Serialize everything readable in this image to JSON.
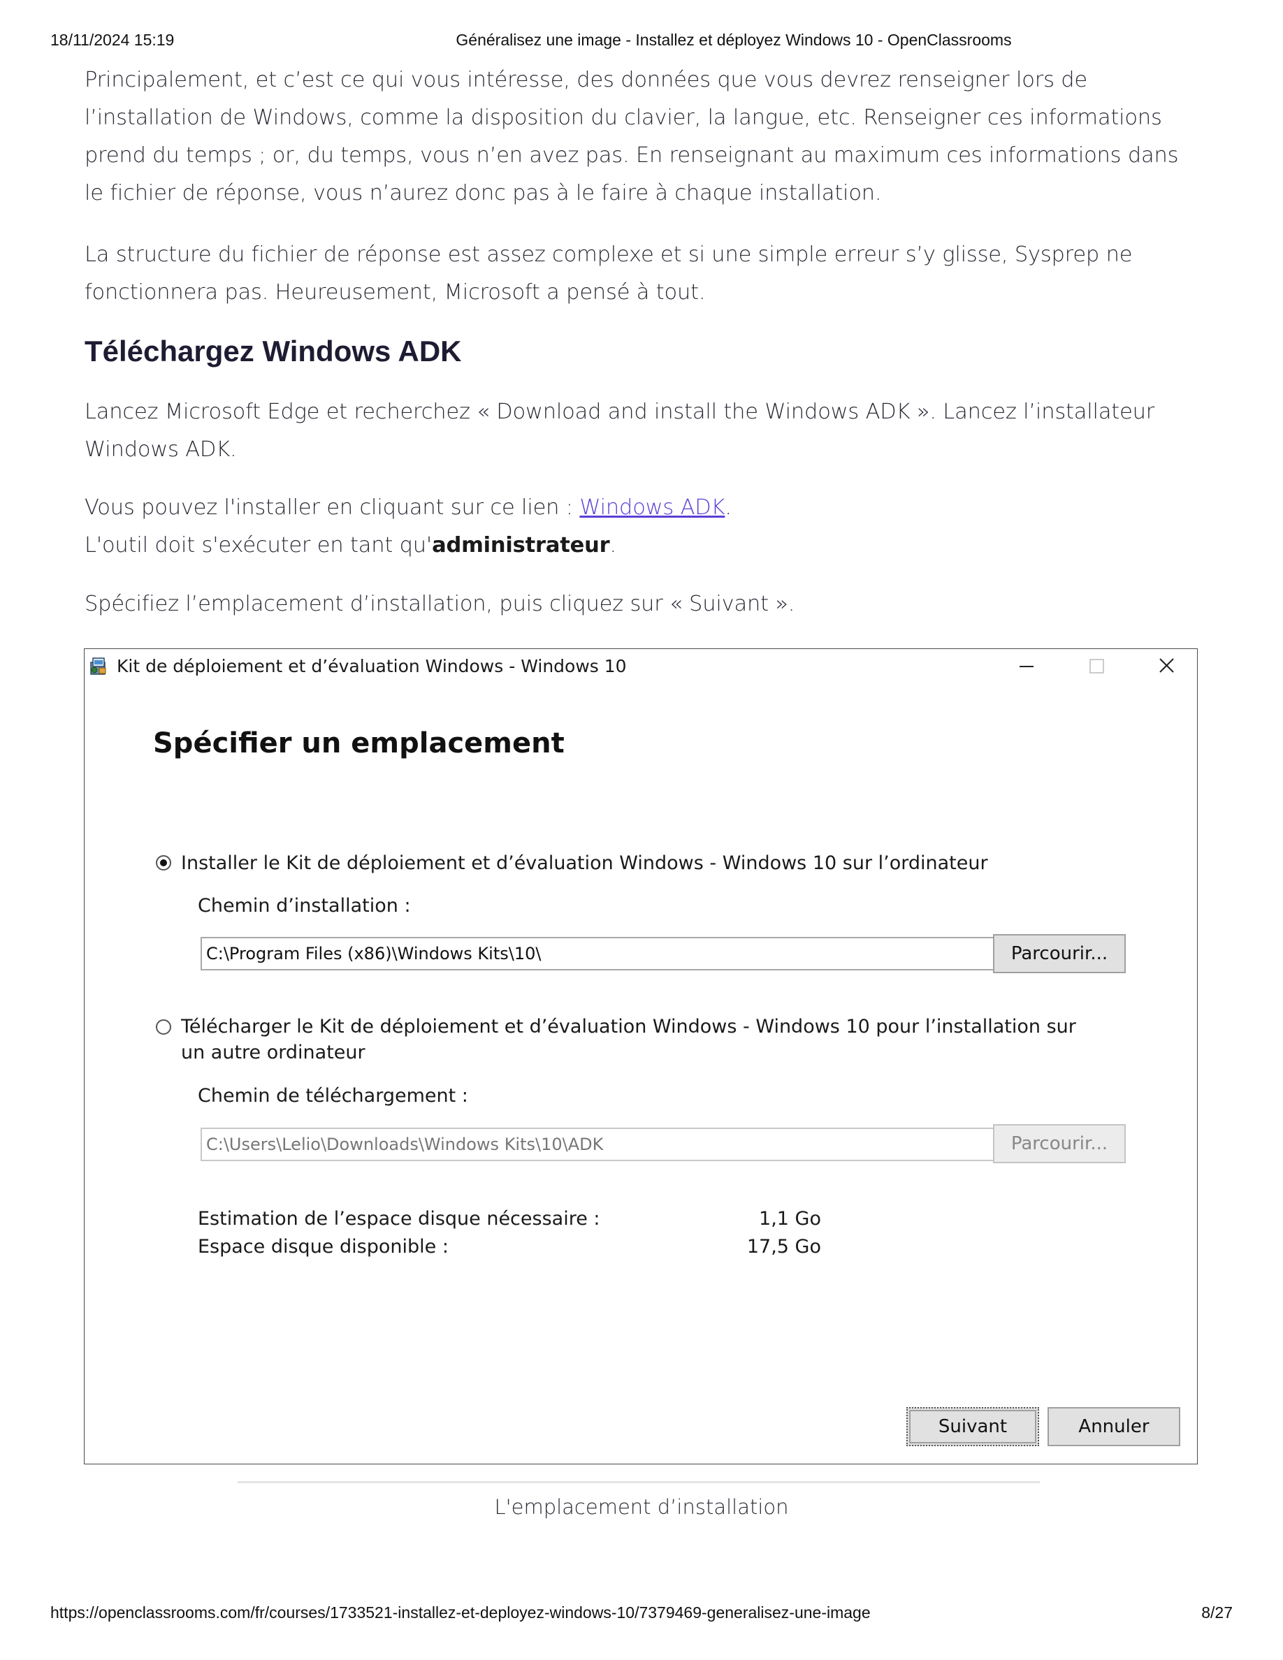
{
  "print_header": {
    "date": "18/11/2024 15:19",
    "title": "Généralisez une image - Installez et déployez Windows 10 - OpenClassrooms"
  },
  "article": {
    "p1": "Principalement, et c’est ce qui vous intéresse, des données que vous devrez renseigner lors de l’installation de Windows, comme la disposition du clavier, la langue, etc. Renseigner ces informations prend du temps ; or, du temps, vous n’en avez pas. En renseignant au maximum ces informations dans le fichier de réponse, vous n’aurez donc pas à le faire à chaque installation.",
    "p2": "La structure du fichier de réponse est assez complexe et si une simple erreur s’y glisse, Sysprep ne fonctionnera pas. Heureusement, Microsoft a pensé à tout.",
    "heading": "Téléchargez Windows ADK",
    "p3": "Lancez Microsoft Edge et recherchez « Download and install the Windows ADK ». Lancez l’installateur Windows ADK.",
    "p4_prefix": "Vous pouvez l'installer en cliquant sur ce lien : ",
    "p4_link": "Windows ADK",
    "p4_suffix": ".",
    "p4b_prefix": "L'outil doit s'exécuter en tant qu'",
    "p4b_bold": "administrateur",
    "p4b_suffix": ".",
    "p5": "Spécifiez l’emplacement d’installation, puis cliquez sur « Suivant ».",
    "caption": "L'emplacement d’installation"
  },
  "dialog": {
    "window_title": "Kit de déploiement et d’évaluation Windows - Windows 10",
    "heading": "Spécifier un emplacement",
    "option1_label": "Installer le Kit de déploiement et d’évaluation Windows - Windows 10 sur l’ordinateur",
    "option1_selected": true,
    "install_path_label": "Chemin d’installation :",
    "install_path_value": "C:\\Program Files (x86)\\Windows Kits\\10\\",
    "browse_label": "Parcourir...",
    "option2_label": "Télécharger le Kit de déploiement et d’évaluation Windows - Windows 10 pour l’installation sur un autre ordinateur",
    "option2_selected": false,
    "download_path_label": "Chemin de téléchargement :",
    "download_path_value": "C:\\Users\\Lelio\\Downloads\\Windows Kits\\10\\ADK",
    "browse2_label": "Parcourir...",
    "disk_required_label": "Estimation de l’espace disque nécessaire :",
    "disk_required_value": "1,1 Go",
    "disk_available_label": "Espace disque disponible :",
    "disk_available_value": "17,5 Go",
    "next_label": "Suivant",
    "cancel_label": "Annuler"
  },
  "print_footer": {
    "url": "https://openclassrooms.com/fr/courses/1733521-installez-et-deployez-windows-10/7379469-generalisez-une-image",
    "page": "8/27"
  }
}
